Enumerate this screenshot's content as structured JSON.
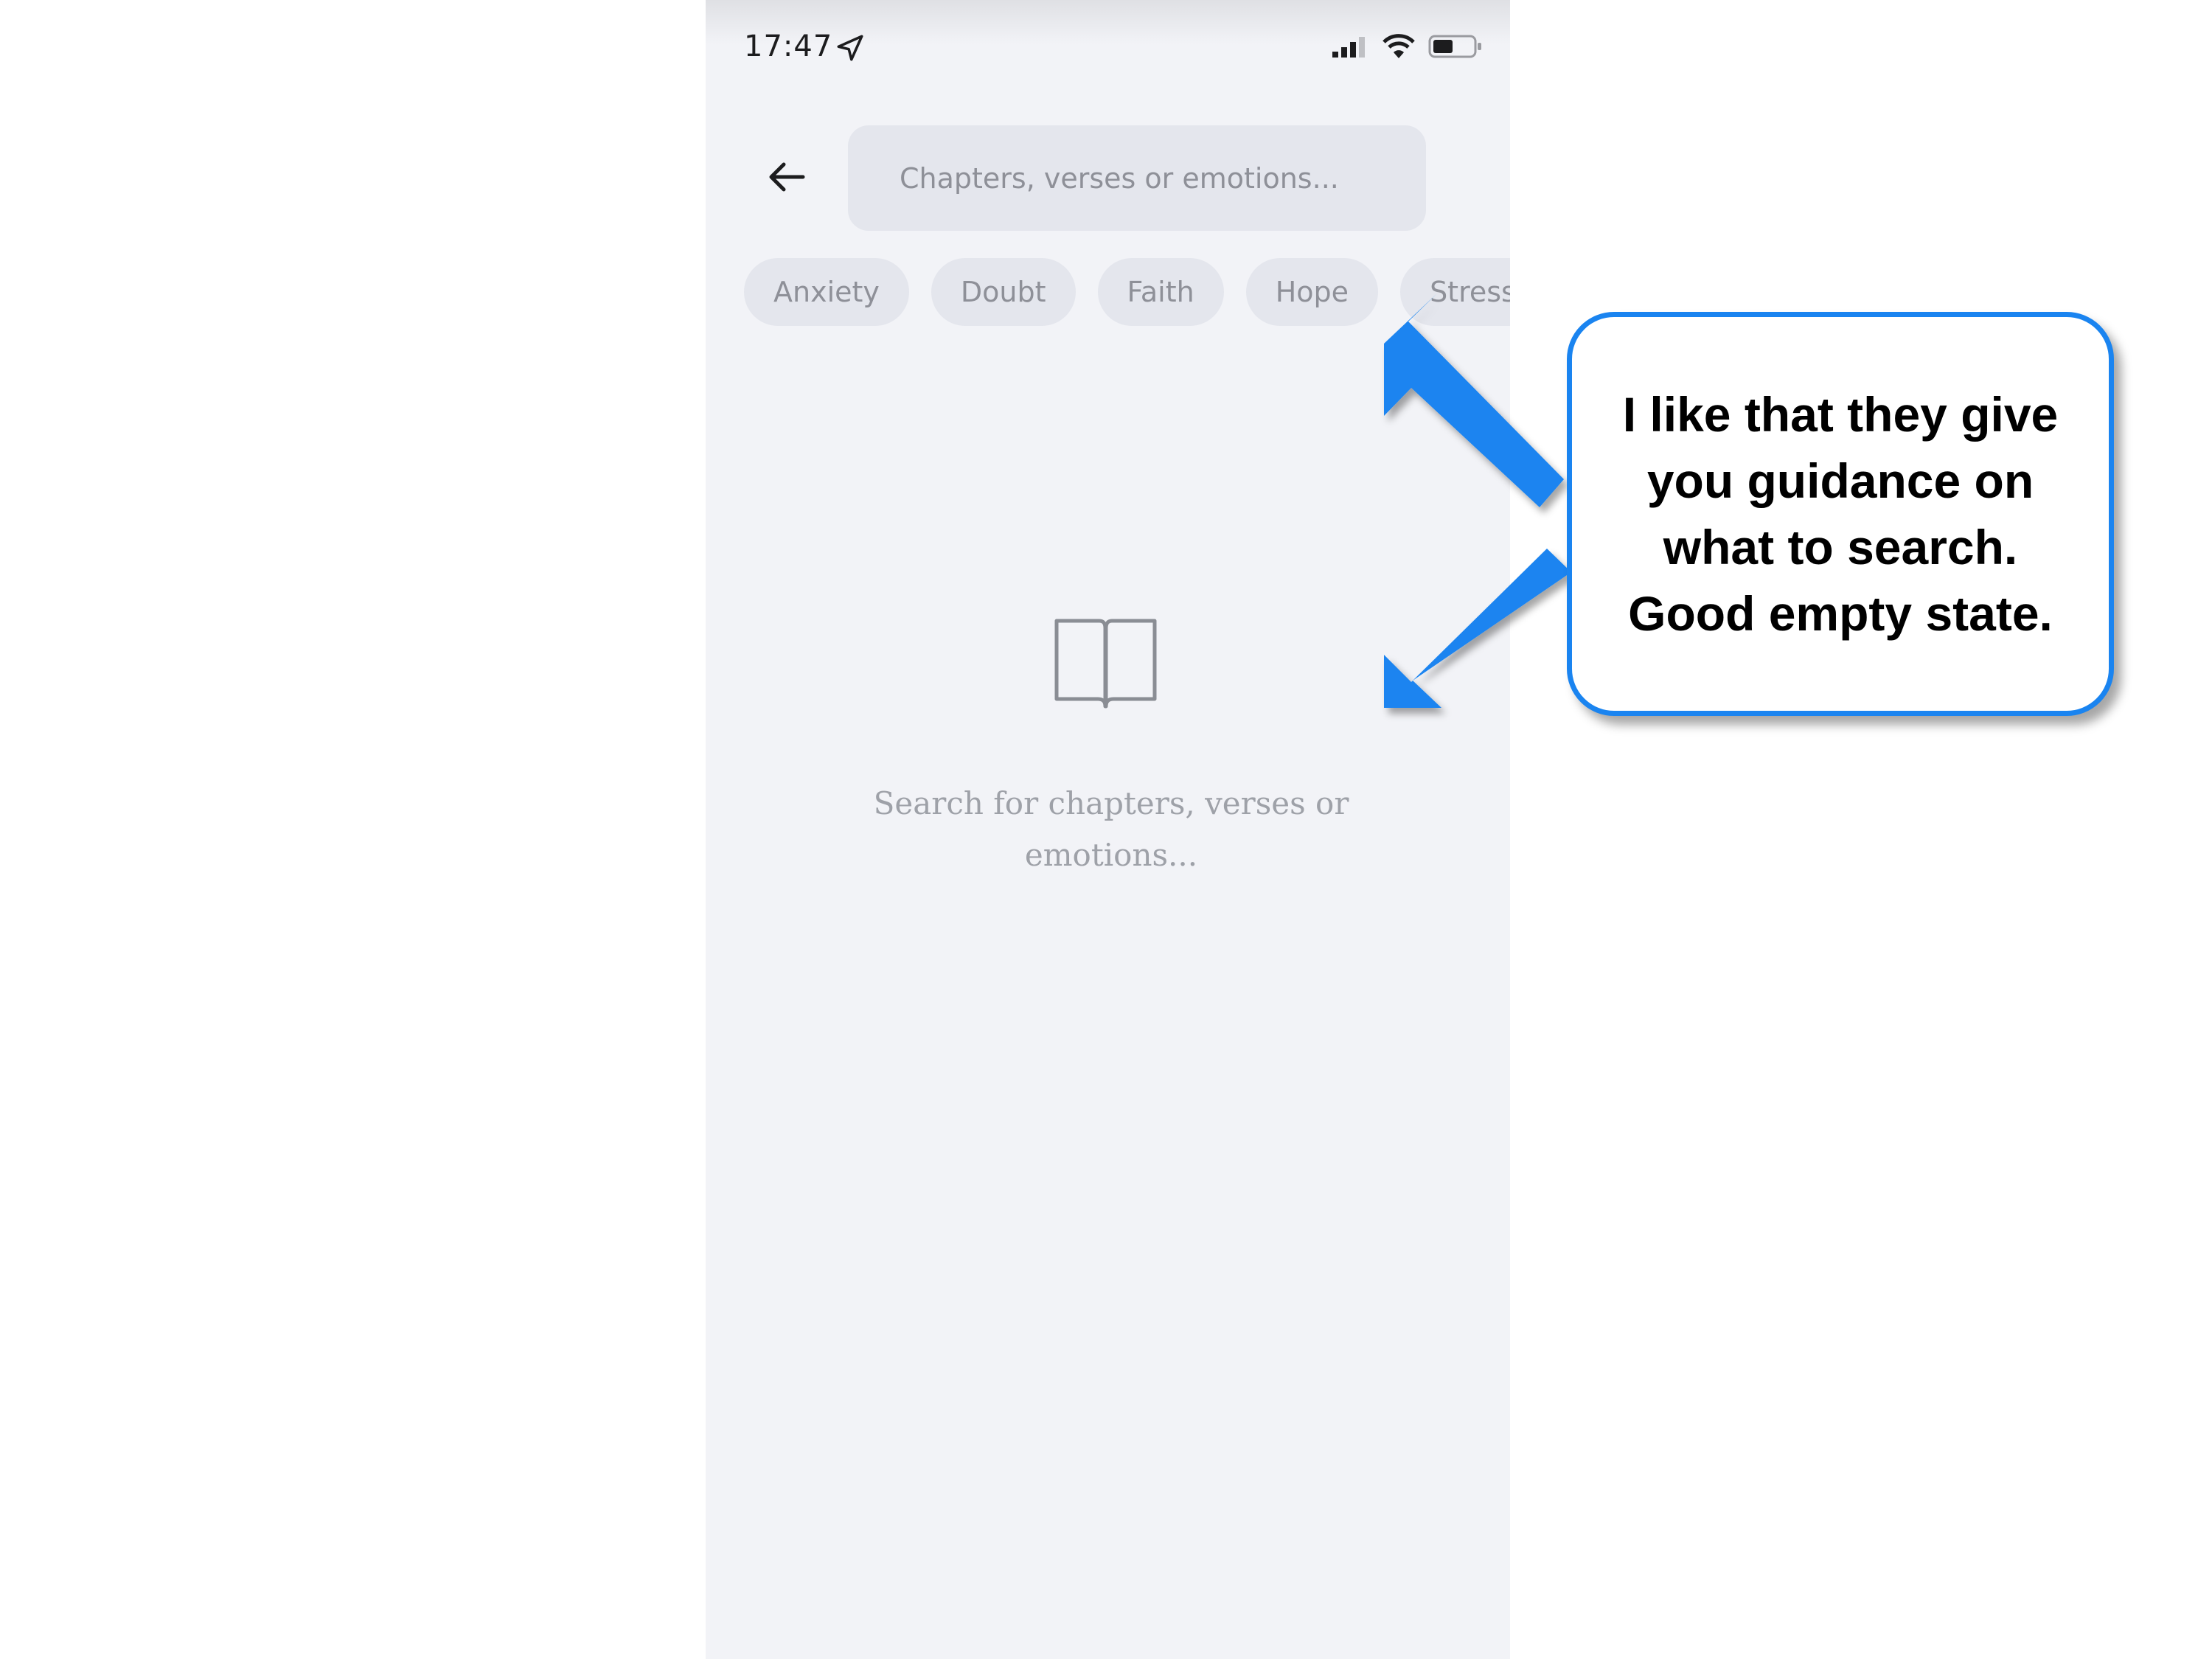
{
  "status_bar": {
    "time": "17:47",
    "icons": [
      "location-arrow-icon",
      "signal-icon",
      "wifi-icon",
      "battery-icon"
    ]
  },
  "header": {
    "back_icon": "back-arrow-icon",
    "search_placeholder": "Chapters, verses or emotions..."
  },
  "chips": [
    {
      "label": "Anxiety"
    },
    {
      "label": "Doubt"
    },
    {
      "label": "Faith"
    },
    {
      "label": "Hope"
    },
    {
      "label": "Stress"
    }
  ],
  "empty_state": {
    "icon": "open-book-icon",
    "line1": "Search for chapters, verses or",
    "line2": "emotions..."
  },
  "annotation": {
    "line1": "I like that they give",
    "line2": "you guidance on",
    "line3": "what to search.",
    "line4": "Good empty state.",
    "accent_color": "#1a84f0"
  }
}
